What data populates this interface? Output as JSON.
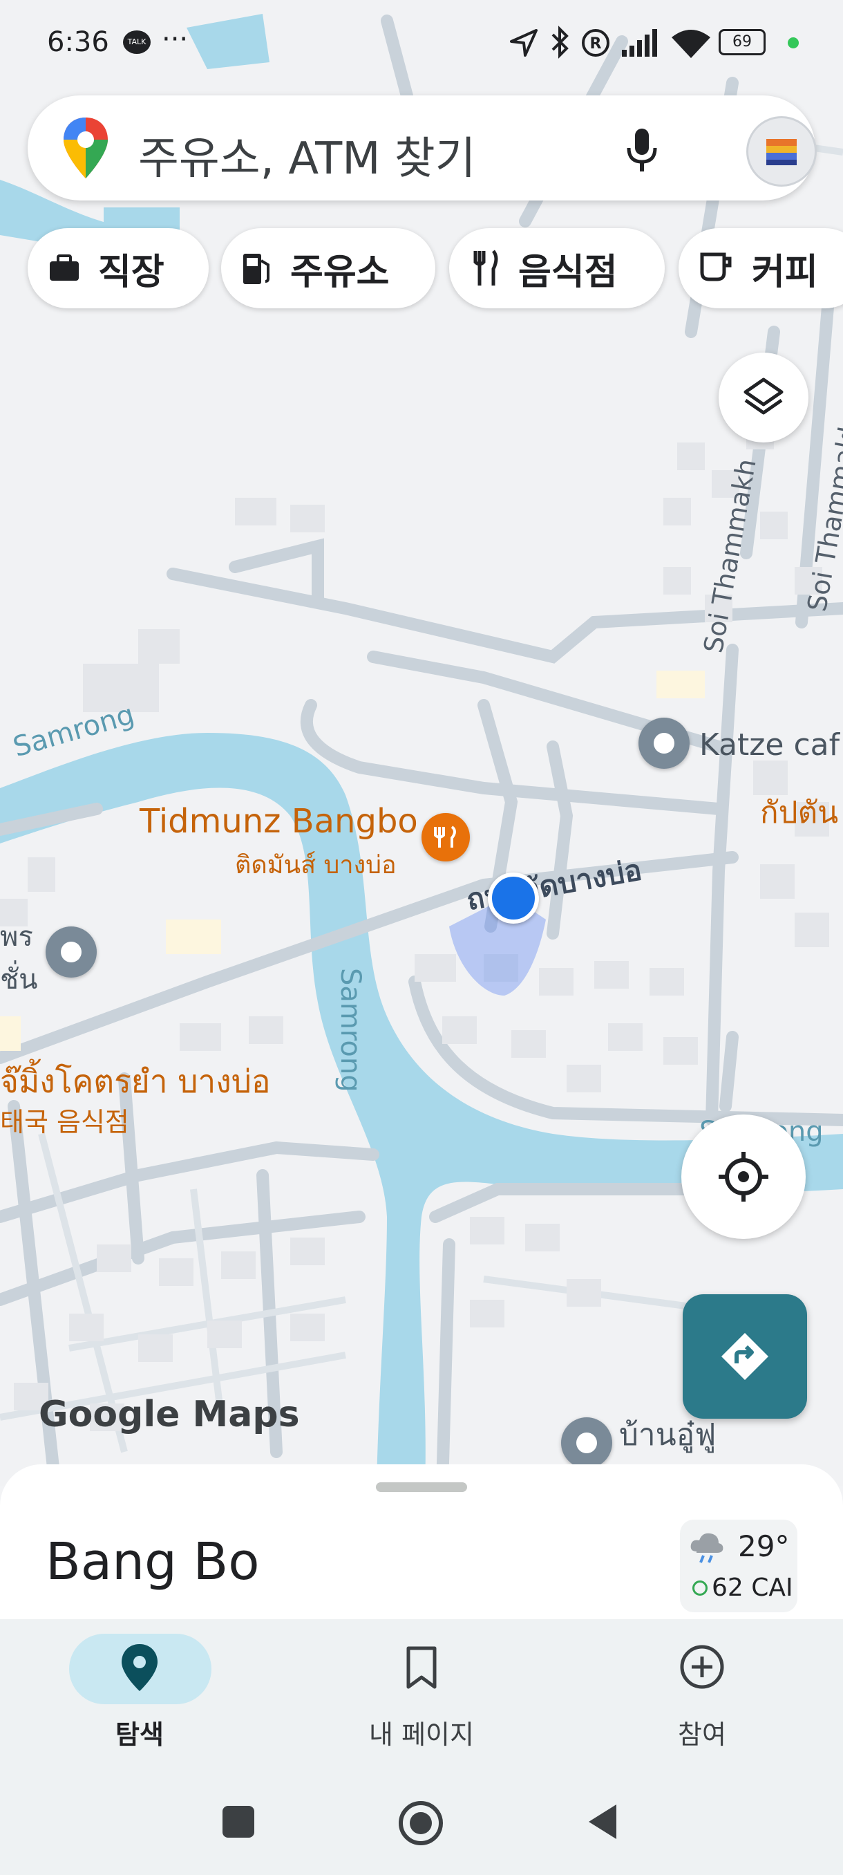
{
  "status_bar": {
    "time": "6:36",
    "dots": "···",
    "battery": "69"
  },
  "search": {
    "placeholder": "주유소, ATM 찾기",
    "mic_icon": "microphone-icon",
    "logo_icon": "google-maps-pin-icon"
  },
  "chips": [
    {
      "label": "직장",
      "icon": "briefcase-icon"
    },
    {
      "label": "주유소",
      "icon": "gas-station-icon"
    },
    {
      "label": "음식점",
      "icon": "fork-knife-icon"
    },
    {
      "label": "커피",
      "icon": "coffee-cup-icon"
    }
  ],
  "map": {
    "water_labels": [
      "Samrong",
      "Samrong",
      "Samrong"
    ],
    "road_labels": [
      "ถนนวัดบางบ่อ",
      "Soi Thammakh",
      "Soi Thammakhun"
    ],
    "pois": {
      "tidmunz_en": "Tidmunz Bangbo",
      "tidmunz_th": "ติดมันส์ บางบ่อ",
      "katze": "Katze caf",
      "kaptan": "กัปตัน",
      "jaeming": "จ๊มิ้งโคตรยำ บางบ่อ",
      "jaeming_sub": "태국 음식점",
      "left_top": "พร",
      "left_bottom": "ชั่น",
      "baan": "บ้านอู๋ฟู"
    },
    "watermark": "Google Maps",
    "accent_water": "#a8d8ea",
    "accent_food": "#e8710a",
    "accent_location": "#1a73e8"
  },
  "sheet": {
    "place": "Bang Bo",
    "temperature": "29°",
    "aqi": "62 CAI"
  },
  "nav": {
    "explore": "탐색",
    "saved": "내 페이지",
    "contribute": "참여"
  }
}
